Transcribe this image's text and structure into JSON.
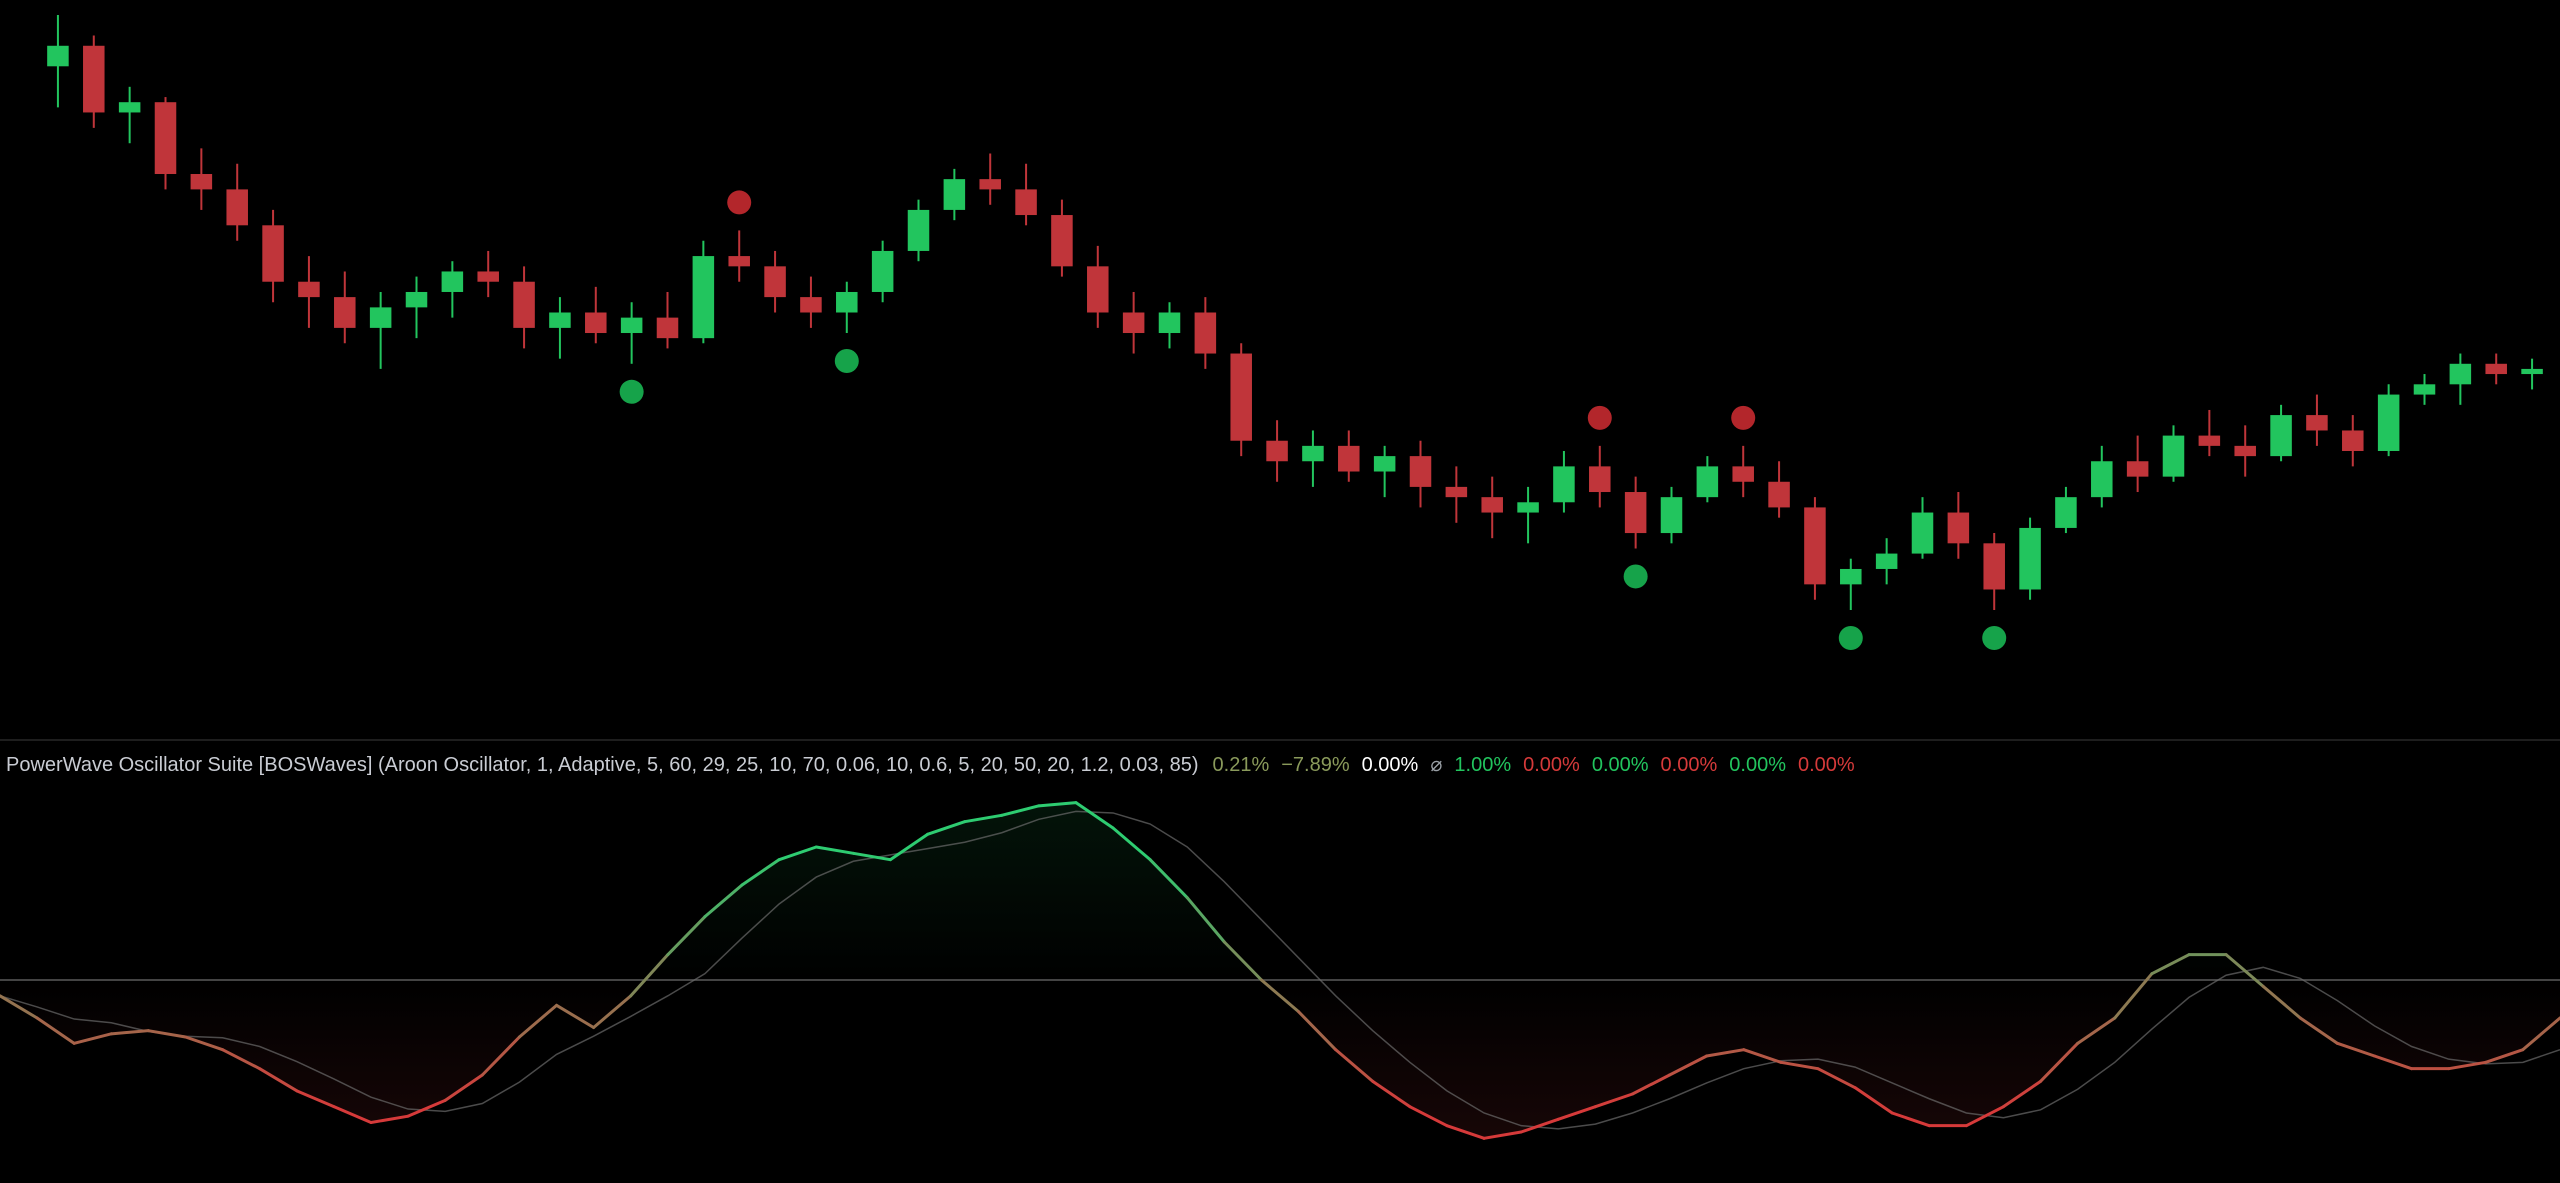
{
  "indicator": {
    "title": "PowerWave Oscillator Suite [BOSWaves] (Aroon Oscillator, 1, Adaptive, 5, 60, 29, 25, 10, 70, 0.06, 10, 0.6, 5, 20, 50, 20, 1.2, 0.03, 85)",
    "values": [
      {
        "text": "0.21%",
        "color": "olive"
      },
      {
        "text": "−7.89%",
        "color": "olive"
      },
      {
        "text": "0.00%",
        "color": "white"
      },
      {
        "text": "⌀",
        "color": "gray"
      },
      {
        "text": "1.00%",
        "color": "green"
      },
      {
        "text": "0.00%",
        "color": "red"
      },
      {
        "text": "0.00%",
        "color": "green"
      },
      {
        "text": "0.00%",
        "color": "red"
      },
      {
        "text": "0.00%",
        "color": "green"
      },
      {
        "text": "0.00%",
        "color": "red"
      }
    ]
  },
  "colors": {
    "background": "#000000",
    "bull": "#22c55e",
    "bear": "#c0353a",
    "olive": "#8a9a5b",
    "divergence": "#2ecc71",
    "hidden_divergence": "#e07a3c",
    "zero_line": "#5a5a5a"
  },
  "chart_data": [
    {
      "type": "candlestick",
      "description_series": "price",
      "candles": [
        [
          100,
          101,
          99.2,
          100.4
        ],
        [
          100.4,
          100.6,
          98.8,
          99.1
        ],
        [
          99.1,
          99.6,
          98.5,
          99.3
        ],
        [
          99.3,
          99.4,
          97.6,
          97.9
        ],
        [
          97.9,
          98.4,
          97.2,
          97.6
        ],
        [
          97.6,
          98.1,
          96.6,
          96.9
        ],
        [
          96.9,
          97.2,
          95.4,
          95.8
        ],
        [
          95.8,
          96.3,
          94.9,
          95.5
        ],
        [
          95.5,
          96.0,
          94.6,
          94.9
        ],
        [
          94.9,
          95.6,
          94.1,
          95.3
        ],
        [
          95.3,
          95.9,
          94.7,
          95.6
        ],
        [
          95.6,
          96.2,
          95.1,
          96.0
        ],
        [
          96.0,
          96.4,
          95.5,
          95.8
        ],
        [
          95.8,
          96.1,
          94.5,
          94.9
        ],
        [
          94.9,
          95.5,
          94.3,
          95.2
        ],
        [
          95.2,
          95.7,
          94.6,
          94.8
        ],
        [
          94.8,
          95.4,
          94.2,
          95.1
        ],
        [
          95.1,
          95.6,
          94.5,
          94.7
        ],
        [
          94.7,
          96.6,
          94.6,
          96.3
        ],
        [
          96.3,
          96.8,
          95.8,
          96.1
        ],
        [
          96.1,
          96.4,
          95.2,
          95.5
        ],
        [
          95.5,
          95.9,
          94.9,
          95.2
        ],
        [
          95.2,
          95.8,
          94.8,
          95.6
        ],
        [
          95.6,
          96.6,
          95.4,
          96.4
        ],
        [
          96.4,
          97.4,
          96.2,
          97.2
        ],
        [
          97.2,
          98.0,
          97.0,
          97.8
        ],
        [
          97.8,
          98.3,
          97.3,
          97.6
        ],
        [
          97.6,
          98.1,
          96.9,
          97.1
        ],
        [
          97.1,
          97.4,
          95.9,
          96.1
        ],
        [
          96.1,
          96.5,
          94.9,
          95.2
        ],
        [
          95.2,
          95.6,
          94.4,
          94.8
        ],
        [
          94.8,
          95.4,
          94.5,
          95.2
        ],
        [
          95.2,
          95.5,
          94.1,
          94.4
        ],
        [
          94.4,
          94.6,
          92.4,
          92.7
        ],
        [
          92.7,
          93.1,
          91.9,
          92.3
        ],
        [
          92.3,
          92.9,
          91.8,
          92.6
        ],
        [
          92.6,
          92.9,
          91.9,
          92.1
        ],
        [
          92.1,
          92.6,
          91.6,
          92.4
        ],
        [
          92.4,
          92.7,
          91.4,
          91.8
        ],
        [
          91.8,
          92.2,
          91.1,
          91.6
        ],
        [
          91.6,
          92.0,
          90.8,
          91.3
        ],
        [
          91.3,
          91.8,
          90.7,
          91.5
        ],
        [
          91.5,
          92.5,
          91.3,
          92.2
        ],
        [
          92.2,
          92.6,
          91.4,
          91.7
        ],
        [
          91.7,
          92.0,
          90.6,
          90.9
        ],
        [
          90.9,
          91.8,
          90.7,
          91.6
        ],
        [
          91.6,
          92.4,
          91.5,
          92.2
        ],
        [
          92.2,
          92.6,
          91.6,
          91.9
        ],
        [
          91.9,
          92.3,
          91.2,
          91.4
        ],
        [
          91.4,
          91.6,
          89.6,
          89.9
        ],
        [
          89.9,
          90.4,
          89.4,
          90.2
        ],
        [
          90.2,
          90.8,
          89.9,
          90.5
        ],
        [
          90.5,
          91.6,
          90.4,
          91.3
        ],
        [
          91.3,
          91.7,
          90.4,
          90.7
        ],
        [
          90.7,
          90.9,
          89.4,
          89.8
        ],
        [
          89.8,
          91.2,
          89.6,
          91.0
        ],
        [
          91.0,
          91.8,
          90.9,
          91.6
        ],
        [
          91.6,
          92.6,
          91.4,
          92.3
        ],
        [
          92.3,
          92.8,
          91.7,
          92.0
        ],
        [
          92.0,
          93.0,
          91.9,
          92.8
        ],
        [
          92.8,
          93.3,
          92.4,
          92.6
        ],
        [
          92.6,
          93.0,
          92.0,
          92.4
        ],
        [
          92.4,
          93.4,
          92.3,
          93.2
        ],
        [
          93.2,
          93.6,
          92.6,
          92.9
        ],
        [
          92.9,
          93.2,
          92.2,
          92.5
        ],
        [
          92.5,
          93.8,
          92.4,
          93.6
        ],
        [
          93.6,
          94.0,
          93.4,
          93.8
        ],
        [
          93.8,
          94.4,
          93.4,
          94.2
        ],
        [
          94.2,
          94.4,
          93.8,
          94.0
        ],
        [
          94.0,
          94.3,
          93.7,
          94.1
        ]
      ]
    },
    {
      "type": "line",
      "description_series": "oscillator",
      "y_zero": 0,
      "series": [
        {
          "values": [
            -5,
            -12,
            -20,
            -17,
            -16,
            -18,
            -22,
            -28,
            -35,
            -40,
            -45,
            -43,
            -38,
            -30,
            -18,
            -8,
            -15,
            -5,
            8,
            20,
            30,
            38,
            42,
            40,
            38,
            46,
            50,
            52,
            55,
            56,
            48,
            38,
            26,
            12,
            0,
            -10,
            -22,
            -32,
            -40,
            -46,
            -50,
            -48,
            -44,
            -40,
            -36,
            -30,
            -24,
            -22,
            -26,
            -28,
            -34,
            -42,
            -46,
            -46,
            -40,
            -32,
            -20,
            -12,
            2,
            8,
            8,
            -2,
            -12,
            -20,
            -24,
            -28,
            -28,
            -26,
            -22,
            -12
          ]
        }
      ]
    }
  ]
}
